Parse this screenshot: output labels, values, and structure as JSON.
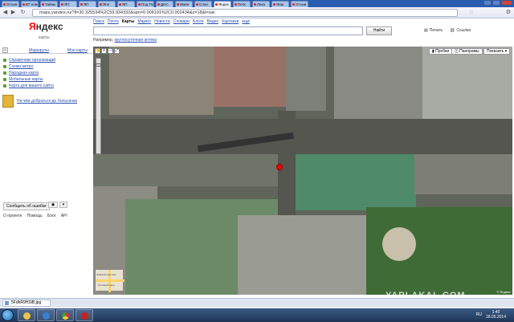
{
  "browser": {
    "tabs": [
      {
        "label": "Oтзыв"
      },
      {
        "label": "ВТ новост"
      },
      {
        "label": "Тайны"
      },
      {
        "label": "ЯП"
      },
      {
        "label": "ЯП"
      },
      {
        "label": "Япл"
      },
      {
        "label": "ЯП"
      },
      {
        "label": "Под По"
      },
      {
        "label": "Детс"
      },
      {
        "label": "Имен"
      },
      {
        "label": "Слон"
      },
      {
        "label": "Яндек"
      },
      {
        "label": "Пепс"
      },
      {
        "label": "Лека"
      },
      {
        "label": "Яиш"
      },
      {
        "label": "Отзыв"
      }
    ],
    "url": "maps.yandex.ru/?ll=30.325534%2C59.934332&spn=0.008191%2C0.002434&z=18&l=sat"
  },
  "header": {
    "logo": "Яндекс",
    "logo_y": "Я",
    "logo_rest": "ндекс",
    "logo_sub": "карты"
  },
  "menu": {
    "items": [
      "Поиск",
      "Почта",
      "Карты",
      "Маркет",
      "Новости",
      "Словари",
      "Блоги",
      "Видео",
      "Картинки",
      "ещё"
    ],
    "current": "Карты"
  },
  "search": {
    "value": "",
    "button": "Найти",
    "print": "Печать",
    "link": "Ссылка",
    "example_prefix": "Например,",
    "example_link": "круглосуточная аптека"
  },
  "sidebar": {
    "tabs": [
      "Маршруты",
      "Мои карты"
    ],
    "links": [
      {
        "label": "Справочник организаций"
      },
      {
        "label": "Схема метро"
      },
      {
        "label": "Народная карта"
      },
      {
        "label": "Мобильные карты"
      },
      {
        "label": "Карта для вашего сайта"
      }
    ],
    "promo": "На чём добраться до Хельсинки",
    "report_button": "Сообщить об ошибке",
    "footer": [
      "О проекте",
      "Помощь",
      "Блог",
      "API"
    ]
  },
  "map": {
    "controls": {
      "traffic": "Пробки",
      "panorama": "Панорамы",
      "show": "Показать"
    },
    "copyright": "© Яндекс",
    "minimap_label_1": "Невский проспект",
    "minimap_label_2": "Гостиный двор"
  },
  "download": {
    "filename": "5FdhR9HSiB.jpg"
  },
  "taskbar": {
    "lang": "RU",
    "time": "1:40",
    "date": "18.05.2014"
  },
  "watermark": "YAPLAKAL.COM"
}
